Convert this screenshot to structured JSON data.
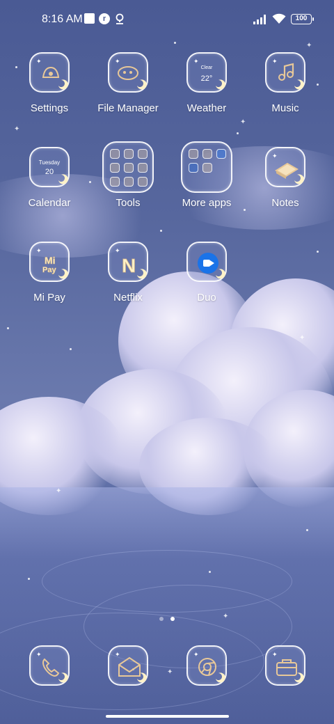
{
  "status_bar": {
    "time": "8:16 AM",
    "notification_icons": [
      "square-icon",
      "r-badge-icon",
      "location-pin-icon"
    ],
    "signal_icon": "signal-bars-icon",
    "wifi_icon": "wifi-icon",
    "battery_level": "100"
  },
  "apps": [
    {
      "label": "Settings",
      "icon": "settings-doodle-icon"
    },
    {
      "label": "File Manager",
      "icon": "folder-doodle-icon"
    },
    {
      "label": "Weather",
      "icon": "weather-icon",
      "condition": "Clear",
      "temperature": "22°"
    },
    {
      "label": "Music",
      "icon": "music-note-icon"
    },
    {
      "label": "Calendar",
      "icon": "calendar-icon",
      "weekday": "Tuesday",
      "day": "20"
    },
    {
      "label": "Tools",
      "icon": "folder-icon"
    },
    {
      "label": "More apps",
      "icon": "folder-icon"
    },
    {
      "label": "Notes",
      "icon": "notes-icon"
    },
    {
      "label": "Mi Pay",
      "icon": "mi-pay-icon",
      "logo_text": "Mi Pay"
    },
    {
      "label": "Netflix",
      "icon": "netflix-icon",
      "logo_text": "N"
    },
    {
      "label": "Duo",
      "icon": "duo-video-icon"
    }
  ],
  "dock": [
    {
      "name": "phone",
      "icon": "phone-icon"
    },
    {
      "name": "messages",
      "icon": "envelope-icon"
    },
    {
      "name": "browser",
      "icon": "chrome-icon"
    },
    {
      "name": "gallery",
      "icon": "briefcase-icon"
    }
  ],
  "page_indicator": {
    "pages": 2,
    "current": 2
  },
  "colors": {
    "duo_blue": "#1a73e8",
    "icon_outline": "#ffffff",
    "doodle_gold": "#e8c898"
  }
}
